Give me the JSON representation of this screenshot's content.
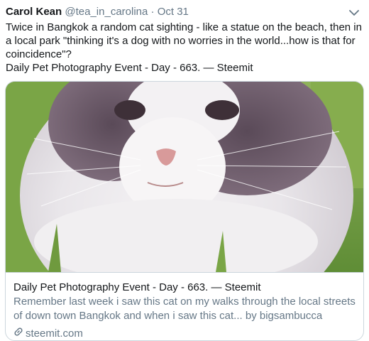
{
  "tweet": {
    "author_name": "Carol Kean",
    "handle": "@tea_in_carolina",
    "separator": "·",
    "date": "Oct 31",
    "caret_icon": "chevron-down-icon",
    "text_line1": "Twice in Bangkok a random cat sighting - like a statue on the beach, then in",
    "text_line2": "a local park \"thinking it's a dog with no worries in the world...how is that for",
    "text_line3": "coincidence\"?",
    "text_line4": "Daily Pet Photography Event - Day - 663. — Steemit"
  },
  "card": {
    "image_alt": "",
    "title": "Daily Pet Photography Event - Day - 663. — Steemit",
    "description_line1": "Remember last week i saw this cat on my walks through the local streets",
    "description_line2": "of down town Bangkok and when i saw this cat... by bigsambucca",
    "link_icon": "link-icon",
    "domain": "steemit.com"
  },
  "colors": {
    "text": "#14171a",
    "secondary": "#657786",
    "border": "#ccd6dd"
  }
}
